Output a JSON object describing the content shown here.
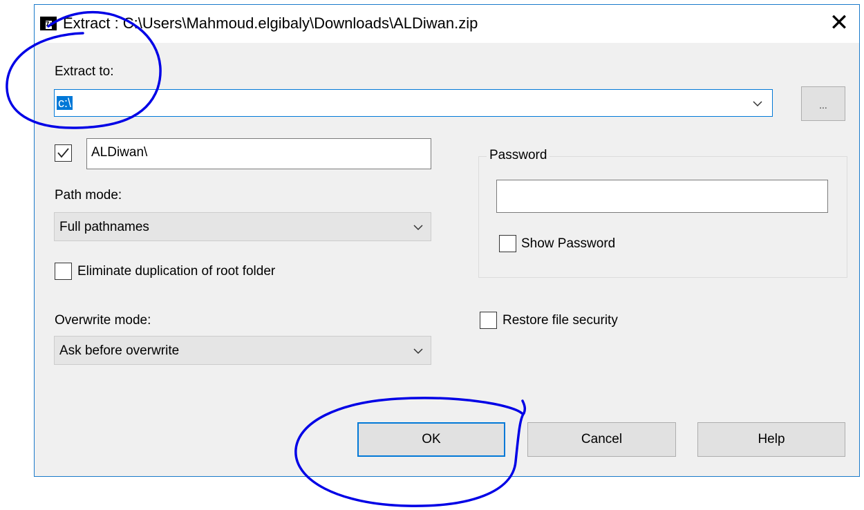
{
  "window": {
    "title": "Extract : C:\\Users\\Mahmoud.elgibaly\\Downloads\\ALDiwan.zip",
    "icon": "7z-app-icon",
    "icon_text": "7z",
    "close_glyph": "✕"
  },
  "extract_to": {
    "label": "Extract to:",
    "value": "c:\\",
    "browse_label": "..."
  },
  "subfolder": {
    "checked": true,
    "value": "ALDiwan\\"
  },
  "path_mode": {
    "label": "Path mode:",
    "selected": "Full pathnames"
  },
  "eliminate_duplication": {
    "label": "Eliminate duplication of root folder",
    "checked": false
  },
  "overwrite_mode": {
    "label": "Overwrite mode:",
    "selected": "Ask before overwrite"
  },
  "password": {
    "group_label": "Password",
    "value": "",
    "show_password_label": "Show Password",
    "show_password_checked": false
  },
  "restore_security": {
    "label": "Restore file security",
    "checked": false
  },
  "buttons": {
    "ok": "OK",
    "cancel": "Cancel",
    "help": "Help"
  },
  "colors": {
    "accent": "#0078d7",
    "dialog_background": "#f0f0f0",
    "annotation_ink": "#0000e6"
  }
}
